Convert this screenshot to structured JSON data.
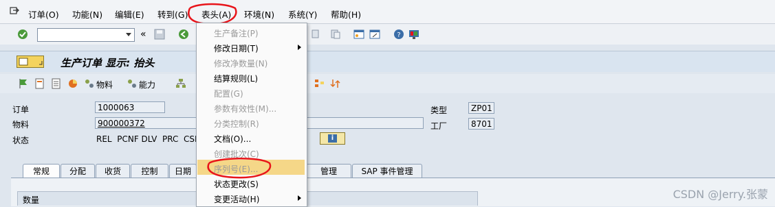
{
  "menubar": {
    "items": [
      "订单(O)",
      "功能(N)",
      "编辑(E)",
      "转到(G)",
      "表头(A)",
      "环境(N)",
      "系统(Y)",
      "帮助(H)"
    ]
  },
  "header": {
    "title": "生产订单 显示: 抬头"
  },
  "app_toolbar": {
    "material_label": "物料",
    "capacity_label": "能力"
  },
  "fields": {
    "order_label": "订单",
    "order_value": "1000063",
    "material_label": "物料",
    "material_value": "900000372",
    "status_label": "状态",
    "status_value": "REL  PCNF DLV  PRC  CSER",
    "type_label": "类型",
    "type_value": "ZP01",
    "plant_label": "工厂",
    "plant_value": "8701"
  },
  "tabs": [
    "常规",
    "分配",
    "收货",
    "控制",
    "日期",
    "管理",
    "SAP 事件管理"
  ],
  "quantity_section": {
    "label": "数量"
  },
  "dropdown": {
    "items": [
      {
        "label": "生产备注(P)",
        "enabled": false
      },
      {
        "label": "修改日期(T)",
        "enabled": true,
        "submenu": true
      },
      {
        "label": "修改净数量(N)",
        "enabled": false
      },
      {
        "label": "结算规则(L)",
        "enabled": true
      },
      {
        "label": "配置(G)",
        "enabled": false
      },
      {
        "label": "参数有效性(M)...",
        "enabled": false
      },
      {
        "label": "分类控制(R)",
        "enabled": false
      },
      {
        "label": "文档(O)...",
        "enabled": true
      },
      {
        "label": "创建批次(C)",
        "enabled": false
      },
      {
        "label": "序列号(E)...",
        "enabled": false,
        "highlighted": true
      },
      {
        "label": "状态更改(S)",
        "enabled": true
      },
      {
        "label": "变更活动(H)",
        "enabled": true,
        "submenu": true
      }
    ]
  },
  "colors": {
    "annotation_red": "#e8141a",
    "highlight": "#f5d788",
    "title_bg": "#d9e4f0"
  },
  "watermark": "CSDN @Jerry.张蒙"
}
